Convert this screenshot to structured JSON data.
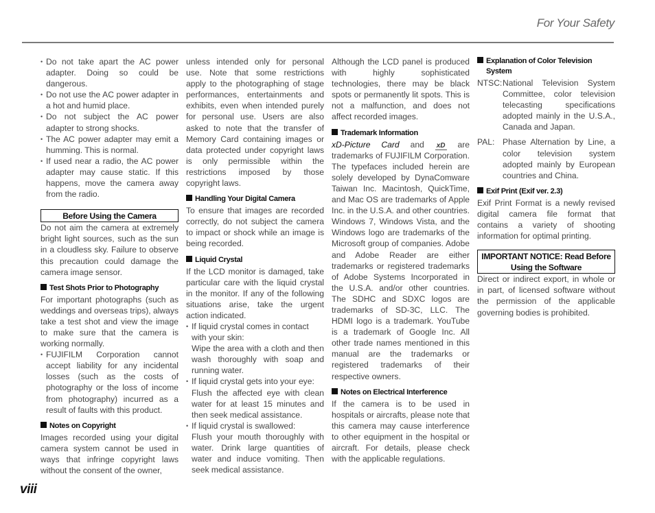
{
  "header": {
    "title": "For Your Safety"
  },
  "page_number": "viii",
  "col1": {
    "bullets_ac": [
      "Do not take apart the AC power adapter. Doing so could be dangerous.",
      "Do not use the AC power adapter in a hot and humid place.",
      "Do not subject the AC power adapter to strong shocks.",
      "The AC power adapter may emit a humming. This is normal.",
      "If used near a radio, the AC power adapter may cause static. If this happens, move the camera away from the radio."
    ],
    "box_heading": "Before Using the Camera",
    "box_text": "Do not aim the camera at extremely bright light sources, such as the sun in a cloudless sky.  Failure to observe this precaution could damage the camera image sensor.",
    "test_shots": {
      "heading": "Test Shots Prior to Photography",
      "text": "For important photographs (such as weddings and overseas trips), always take a test shot and view the image to make sure that the camera is working normally.",
      "bullet": "FUJIFILM Corporation cannot accept liability for any incidental losses (such as the costs of photography or the loss of income from photography) incurred as a result of faults with this product."
    },
    "copyright": {
      "heading": "Notes on Copyright",
      "text": "Images recorded using your digital camera system cannot be used in ways that infringe copyright laws without the consent of the owner,"
    }
  },
  "col2": {
    "copyright_cont": "unless intended only for personal use. Note that some restrictions apply to the photographing of stage performances, entertainments and exhibits, even when intended purely for personal use. Users are also asked to note that the transfer of Memory Card containing images or data protected under copyright laws is only permissible within the restrictions imposed by those copyright laws.",
    "handling": {
      "heading": "Handling Your Digital Camera",
      "text": "To ensure that images are recorded correctly, do not subject the camera to impact or shock while an image is being recorded."
    },
    "liquid": {
      "heading": "Liquid Crystal",
      "text": "If the LCD monitor is damaged, take particular care with the liquid crystal in the monitor. If any of the following situations arise, take the urgent action indicated.",
      "items": [
        {
          "cond": "If liquid crystal comes in contact with your skin:",
          "action": "Wipe the area with a cloth and then wash thoroughly with soap and running water."
        },
        {
          "cond": "If liquid crystal gets into your eye:",
          "action": "Flush the affected eye with clean water for at least 15 minutes and then seek medical assistance."
        },
        {
          "cond": "If liquid crystal is swallowed:",
          "action": "Flush your mouth thoroughly with water. Drink large quantities of water and induce vomiting. Then seek medical assistance."
        }
      ]
    }
  },
  "col3": {
    "lcd_text": "Although the LCD panel is produced with highly sophisticated technologies, there may be black spots or permanently lit spots.  This is not a malfunction, and does not affect recorded images.",
    "trademark": {
      "heading": "Trademark Information",
      "xd_name": "xD-Picture Card",
      "and": " and ",
      "logo_label": "xD",
      "text": " are trademarks of FUJIFILM Corporation.  The typefaces included herein are solely developed by DynaComware Taiwan Inc.  Macintosh, QuickTime, and Mac OS are trademarks of Apple Inc. in the U.S.A. and other countries. Windows 7, Windows Vista, and the Windows logo are trademarks of the Microsoft group of companies. Adobe and Adobe Reader are either trademarks or registered trademarks of Adobe Systems Incorporated in the U.S.A. and/or other countries. The SDHC and SDXC logos are trademarks of SD-3C, LLC.  The HDMI logo is a trademark.  YouTube is a trademark of Google Inc.  All other trade names mentioned in this manual are the trademarks or registered trademarks of their respective owners."
    },
    "electrical": {
      "heading": "Notes on Electrical Interference",
      "text": "If the camera is to be used in hospitals or aircrafts, please note that this camera may cause interference to other equipment in the hospital or aircraft. For details, please check with the applicable regulations."
    }
  },
  "col4": {
    "tv": {
      "heading_line1": "Explanation of Color Television",
      "heading_line2": "System",
      "defs": [
        {
          "term": "NTSC:",
          "desc": "National Television System Committee, color television telecasting specifications adopted mainly in the U.S.A., Canada and Japan."
        },
        {
          "term": "PAL:",
          "desc": "Phase Alternation by Line, a color television system adopted mainly by European countries and China."
        }
      ]
    },
    "exif": {
      "heading": "Exif Print (Exif ver. 2.3)",
      "text": "Exif Print Format is a newly revised digital camera file format that contains a variety of shooting information for optimal printing."
    },
    "notice": {
      "heading": "IMPORTANT NOTICE: Read Before Using the Software",
      "text": "Direct or indirect export, in whole or in part, of licensed software without the permission of the applicable governing bodies is prohibited."
    }
  }
}
